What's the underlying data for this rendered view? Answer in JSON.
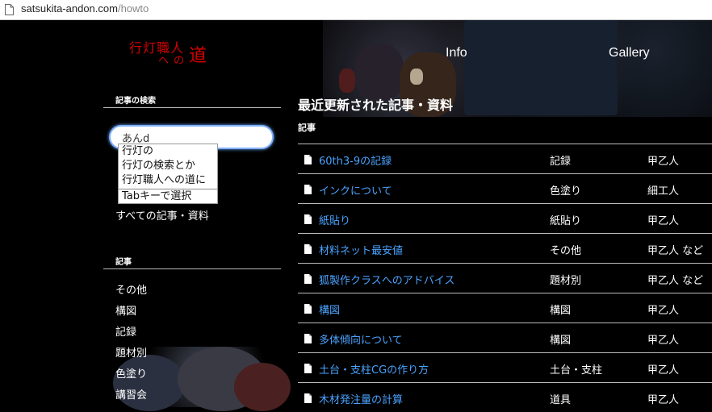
{
  "browser": {
    "url_host": "satsukita-andon.com",
    "url_path": "/howto"
  },
  "header": {
    "logo_line1": "行灯職人",
    "logo_line2": "への",
    "logo_line3": "道",
    "nav": [
      "Info",
      "Gallery"
    ]
  },
  "sidebar": {
    "search_heading": "記事の検索",
    "search_value": "あんd",
    "autocomplete": {
      "items": [
        "行灯の",
        "行灯の検索とか",
        "行灯職人への道に"
      ],
      "hint": "Tabキーで選択"
    },
    "all_link": "すべての記事・資料",
    "category_heading": "記事",
    "categories": [
      "その他",
      "構図",
      "記録",
      "題材別",
      "色塗り",
      "講習会"
    ]
  },
  "main": {
    "title": "最近更新された記事・資料",
    "subtitle": "記事",
    "articles": [
      {
        "title": "60th3-9の記録",
        "category": "記録",
        "author": "甲乙人"
      },
      {
        "title": "インクについて",
        "category": "色塗り",
        "author": "細工人"
      },
      {
        "title": "紙貼り",
        "category": "紙貼り",
        "author": "甲乙人"
      },
      {
        "title": "材料ネット最安値",
        "category": "その他",
        "author": "甲乙人 など"
      },
      {
        "title": "狐製作クラスへのアドバイス",
        "category": "題材別",
        "author": "甲乙人 など"
      },
      {
        "title": "構図",
        "category": "構図",
        "author": "甲乙人"
      },
      {
        "title": "多体傾向について",
        "category": "構図",
        "author": "甲乙人"
      },
      {
        "title": "土台・支柱CGの作り方",
        "category": "土台・支柱",
        "author": "甲乙人"
      },
      {
        "title": "木材発注量の計算",
        "category": "道具",
        "author": "甲乙人"
      }
    ]
  },
  "colors": {
    "background": "#000000",
    "link": "#4aa3ff",
    "logo": "#d60000",
    "focus_ring": "#7fb0ff"
  }
}
